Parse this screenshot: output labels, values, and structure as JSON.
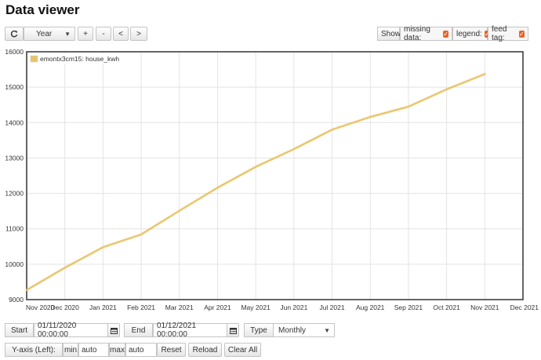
{
  "page_title": "Data viewer",
  "toolbar": {
    "reload_icon": "refresh-icon",
    "interval_value": "Year",
    "zoom_in_label": "+",
    "zoom_out_label": "-",
    "pan_left_label": "<",
    "pan_right_label": ">"
  },
  "options": {
    "show_label": "Show",
    "missing_data_label": "missing data:",
    "legend_label": "legend:",
    "feed_tag_label": "feed tag:",
    "missing_data_checked": true,
    "legend_checked": true,
    "feed_tag_checked": true,
    "check_color": "#e8632a"
  },
  "controls": {
    "start_label": "Start",
    "start_value": "01/11/2020 00:00:00",
    "end_label": "End",
    "end_value": "01/12/2021 00:00:00",
    "type_label": "Type",
    "type_value": "Monthly",
    "yaxis_label": "Y-axis (Left):",
    "min_label": "min",
    "min_value": "auto",
    "max_label": "max",
    "max_value": "auto",
    "reset_label": "Reset",
    "reload_label": "Reload",
    "clear_all_label": "Clear All",
    "calendar_icon": "calendar-icon"
  },
  "chart_data": {
    "type": "line",
    "title": "",
    "xlabel": "",
    "ylabel": "",
    "ylim": [
      9000,
      16000
    ],
    "yticks": [
      9000,
      10000,
      11000,
      12000,
      13000,
      14000,
      15000,
      16000
    ],
    "xticks": [
      "Nov 2020",
      "Dec 2020",
      "Jan 2021",
      "Feb 2021",
      "Mar 2021",
      "Apr 2021",
      "May 2021",
      "Jun 2021",
      "Jul 2021",
      "Aug 2021",
      "Sep 2021",
      "Oct 2021",
      "Nov 2021",
      "Dec 2021"
    ],
    "grid": true,
    "legend_position": "top-left",
    "series": [
      {
        "name": "emontx3cm15: house_kwh",
        "color": "#e8c468",
        "x": [
          "Nov 2020",
          "Dec 2020",
          "Jan 2021",
          "Feb 2021",
          "Mar 2021",
          "Apr 2021",
          "May 2021",
          "Jun 2021",
          "Jul 2021",
          "Aug 2021",
          "Sep 2021",
          "Oct 2021",
          "Nov 2021"
        ],
        "values": [
          9270,
          9900,
          10480,
          10840,
          11510,
          12160,
          12750,
          13250,
          13800,
          14160,
          14450,
          14940,
          15370
        ]
      }
    ]
  }
}
